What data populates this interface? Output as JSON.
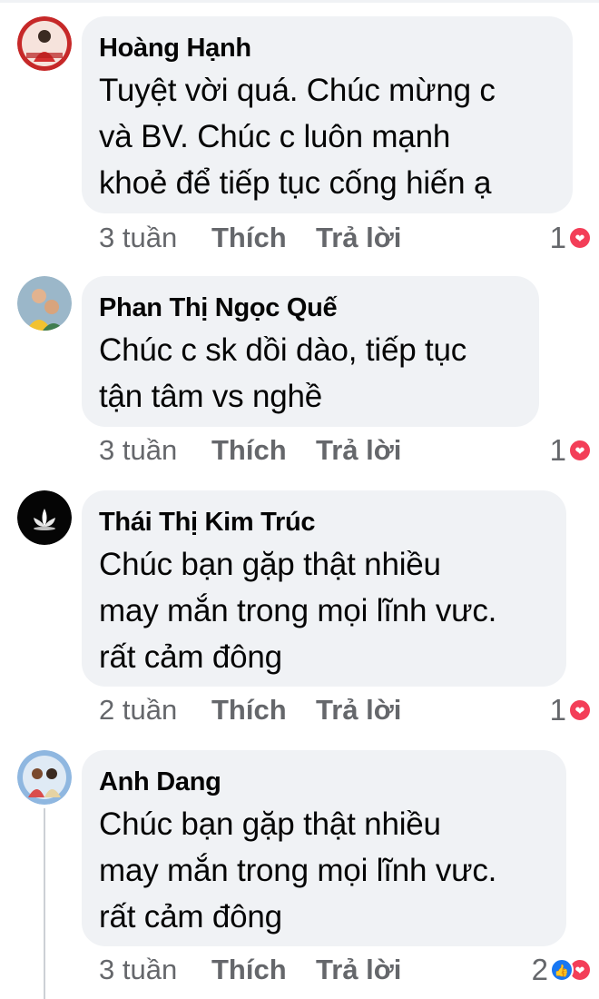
{
  "comments": [
    {
      "author": "Hoàng Hạnh",
      "text": "Tuyệt vời quá. Chúc mừng c\nvà BV. Chúc c luôn mạnh\nkhoẻ để tiếp tục cống hiến ạ",
      "time": "3 tuần",
      "like_label": "Thích",
      "reply_label": "Trả lời",
      "reaction_count": "1",
      "reactions": [
        "heart-icon"
      ]
    },
    {
      "author": "Phan Thị Ngọc Quế",
      "text": "Chúc c sk dồi dào, tiếp tục\ntận tâm vs nghề",
      "time": "3 tuần",
      "like_label": "Thích",
      "reply_label": "Trả lời",
      "reaction_count": "1",
      "reactions": [
        "heart-icon"
      ]
    },
    {
      "author": "Thái Thị Kim Trúc",
      "text": "Chúc bạn gặp thật nhiều\nmay mắn trong mọi lĩnh vưc.\nrất cảm đông",
      "time": "2 tuần",
      "like_label": "Thích",
      "reply_label": "Trả lời",
      "reaction_count": "1",
      "reactions": [
        "heart-icon"
      ]
    },
    {
      "author": "Anh Dang",
      "text": "Chúc bạn gặp thật nhiều\nmay mắn trong mọi lĩnh vưc.\nrất cảm đông",
      "time": "3 tuần",
      "like_label": "Thích",
      "reply_label": "Trả lời",
      "reaction_count": "2",
      "reactions": [
        "like-icon",
        "heart-icon"
      ]
    }
  ],
  "colors": {
    "bubble": "#f0f2f5",
    "meta_text": "#65676b",
    "heart": "#f33e58",
    "like": "#1877f2"
  }
}
